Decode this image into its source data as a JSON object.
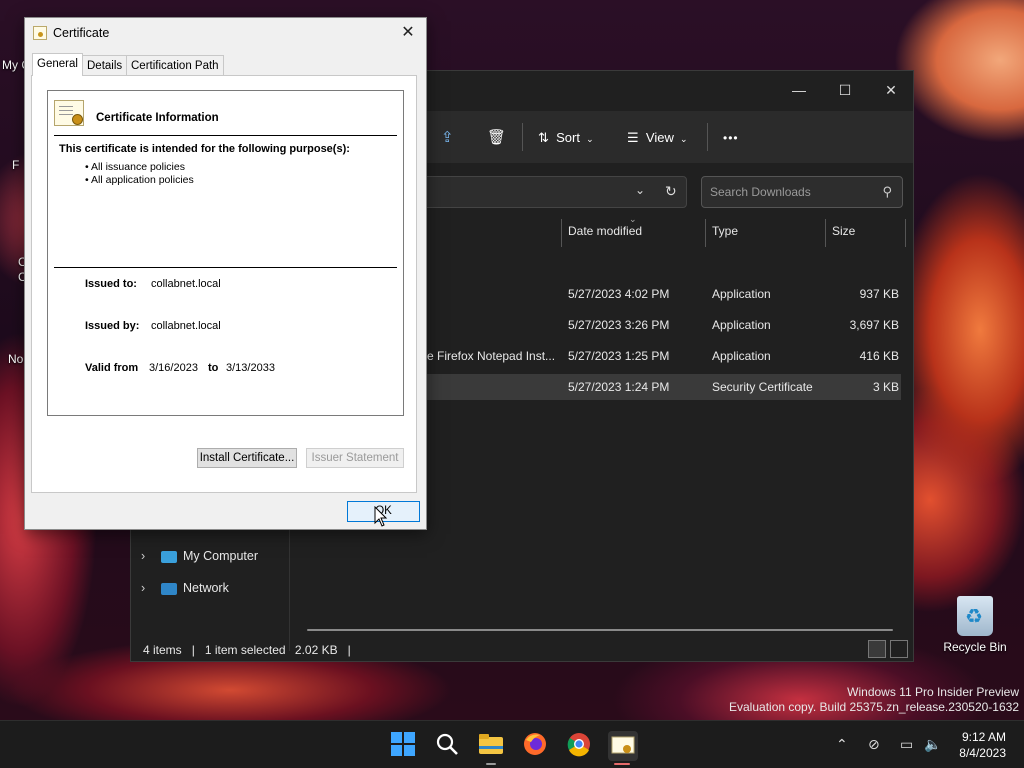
{
  "desktop": {
    "recycle_bin_label": "Recycle Bin",
    "watermark_line1": "Windows 11 Pro Insider Preview",
    "watermark_line2": "Evaluation copy. Build 25375.zn_release.230520-1632",
    "left_labels": [
      "My C",
      "F",
      "C",
      "C",
      "No"
    ]
  },
  "explorer": {
    "toolbar": {
      "sort_label": "Sort",
      "view_label": "View",
      "more_label": "•••"
    },
    "search_placeholder": "Search Downloads",
    "columns": [
      "Date modified",
      "Type",
      "Size"
    ],
    "files": [
      {
        "name": "",
        "date": "5/27/2023 4:02 PM",
        "type": "Application",
        "size": "937 KB"
      },
      {
        "name": "",
        "date": "5/27/2023 3:26 PM",
        "type": "Application",
        "size": "3,697 KB"
      },
      {
        "name": "e Firefox Notepad Inst...",
        "date": "5/27/2023 1:25 PM",
        "type": "Application",
        "size": "416 KB"
      },
      {
        "name": "",
        "date": "5/27/2023 1:24 PM",
        "type": "Security Certificate",
        "size": "3 KB"
      }
    ],
    "nav": [
      {
        "label": "My Computer"
      },
      {
        "label": "Network"
      }
    ],
    "status": {
      "items": "4 items",
      "selected": "1 item selected",
      "size": "2.02 KB"
    }
  },
  "dialog": {
    "title": "Certificate",
    "tabs": [
      "General",
      "Details",
      "Certification Path"
    ],
    "heading": "Certificate Information",
    "purpose_title": "This certificate is intended for the following purpose(s):",
    "purposes": [
      "• All issuance policies",
      "• All application policies"
    ],
    "issued_to_label": "Issued to:",
    "issued_to_value": "collabnet.local",
    "issued_by_label": "Issued by:",
    "issued_by_value": "collabnet.local",
    "valid_from_label": "Valid from",
    "valid_from_value": "3/16/2023",
    "valid_to_label": "to",
    "valid_to_value": "3/13/2033",
    "install_button": "Install Certificate...",
    "issuer_statement_button": "Issuer Statement",
    "ok_button": "OK"
  },
  "taskbar": {
    "time": "9:12 AM",
    "date": "8/4/2023"
  }
}
